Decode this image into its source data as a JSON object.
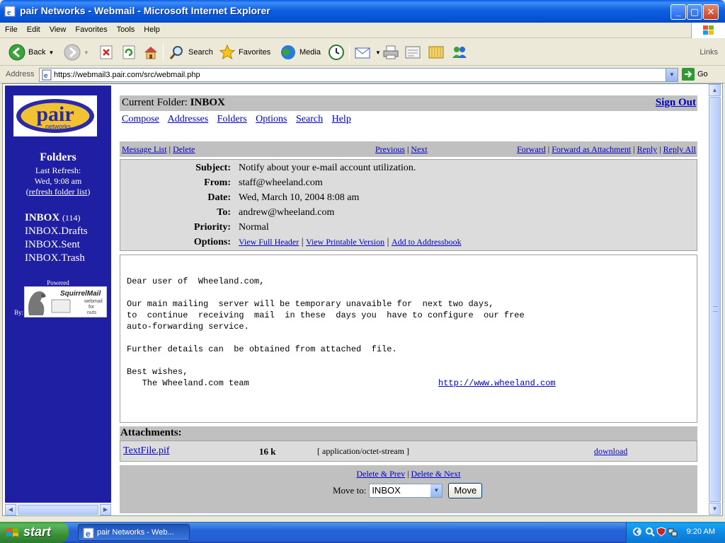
{
  "window": {
    "title": "pair Networks - Webmail - Microsoft Internet Explorer"
  },
  "menu": [
    "File",
    "Edit",
    "View",
    "Favorites",
    "Tools",
    "Help"
  ],
  "toolbar": {
    "back": "Back",
    "search": "Search",
    "favorites": "Favorites",
    "media": "Media",
    "links": "Links"
  },
  "address": {
    "label": "Address",
    "url": "https://webmail3.pair.com/src/webmail.php",
    "go": "Go"
  },
  "sidebar": {
    "logo_text": "pair",
    "logo_sub": "networks",
    "folders_title": "Folders",
    "last_refresh": "Last Refresh:",
    "refresh_time": "Wed, 9:08 am",
    "refresh_link": "refresh folder list",
    "folders": [
      {
        "name": "INBOX",
        "count": "(114)"
      },
      {
        "name": "INBOX.Drafts"
      },
      {
        "name": "INBOX.Sent"
      },
      {
        "name": "INBOX.Trash"
      }
    ],
    "powered": "Powered",
    "by": "By:",
    "sq_logo": "SquirrelMail",
    "sq_sub1": "webmail",
    "sq_sub2": "for",
    "sq_sub3": "nuts"
  },
  "main": {
    "current_folder_label": "Current Folder:",
    "current_folder": "INBOX",
    "sign_out": "Sign Out",
    "menu": [
      "Compose",
      "Addresses",
      "Folders",
      "Options",
      "Search",
      "Help"
    ],
    "nav": {
      "message_list": "Message List",
      "delete": "Delete",
      "previous": "Previous",
      "next": "Next",
      "forward": "Forward",
      "forward_attachment": "Forward as Attachment",
      "reply": "Reply",
      "reply_all": "Reply All"
    },
    "headers": [
      {
        "k": "Subject:",
        "v": "Notify about your e-mail account utilization."
      },
      {
        "k": "From:",
        "v": "staff@wheeland.com"
      },
      {
        "k": "Date:",
        "v": "Wed, March 10, 2004 8:08 am"
      },
      {
        "k": "To:",
        "v": "andrew@wheeland.com"
      },
      {
        "k": "Priority:",
        "v": "Normal"
      }
    ],
    "options_label": "Options:",
    "options": [
      "View Full Header",
      "View Printable Version",
      "Add to Addressbook"
    ],
    "body": "Dear user of  Wheeland.com,\n\nOur main mailing  server will be temporary unavaible for  next two days,\nto  continue  receiving  mail  in these  days you  have to configure  our free\nauto-forwarding service.\n\nFurther details can  be obtained from attached  file.\n\nBest wishes,\n   The Wheeland.com team",
    "body_link": "http://www.wheeland.com",
    "attachments_title": "Attachments:",
    "attachment": {
      "name": "TextFile.pif",
      "size": "16 k",
      "type": "[ application/octet-stream ]",
      "download": "download"
    },
    "delete_prev": "Delete & Prev",
    "delete_next": "Delete & Next",
    "move_to": "Move to:",
    "move_select": "INBOX",
    "move_button": "Move"
  },
  "taskbar": {
    "start": "start",
    "task": "pair Networks - Web...",
    "clock": "9:20 AM"
  }
}
